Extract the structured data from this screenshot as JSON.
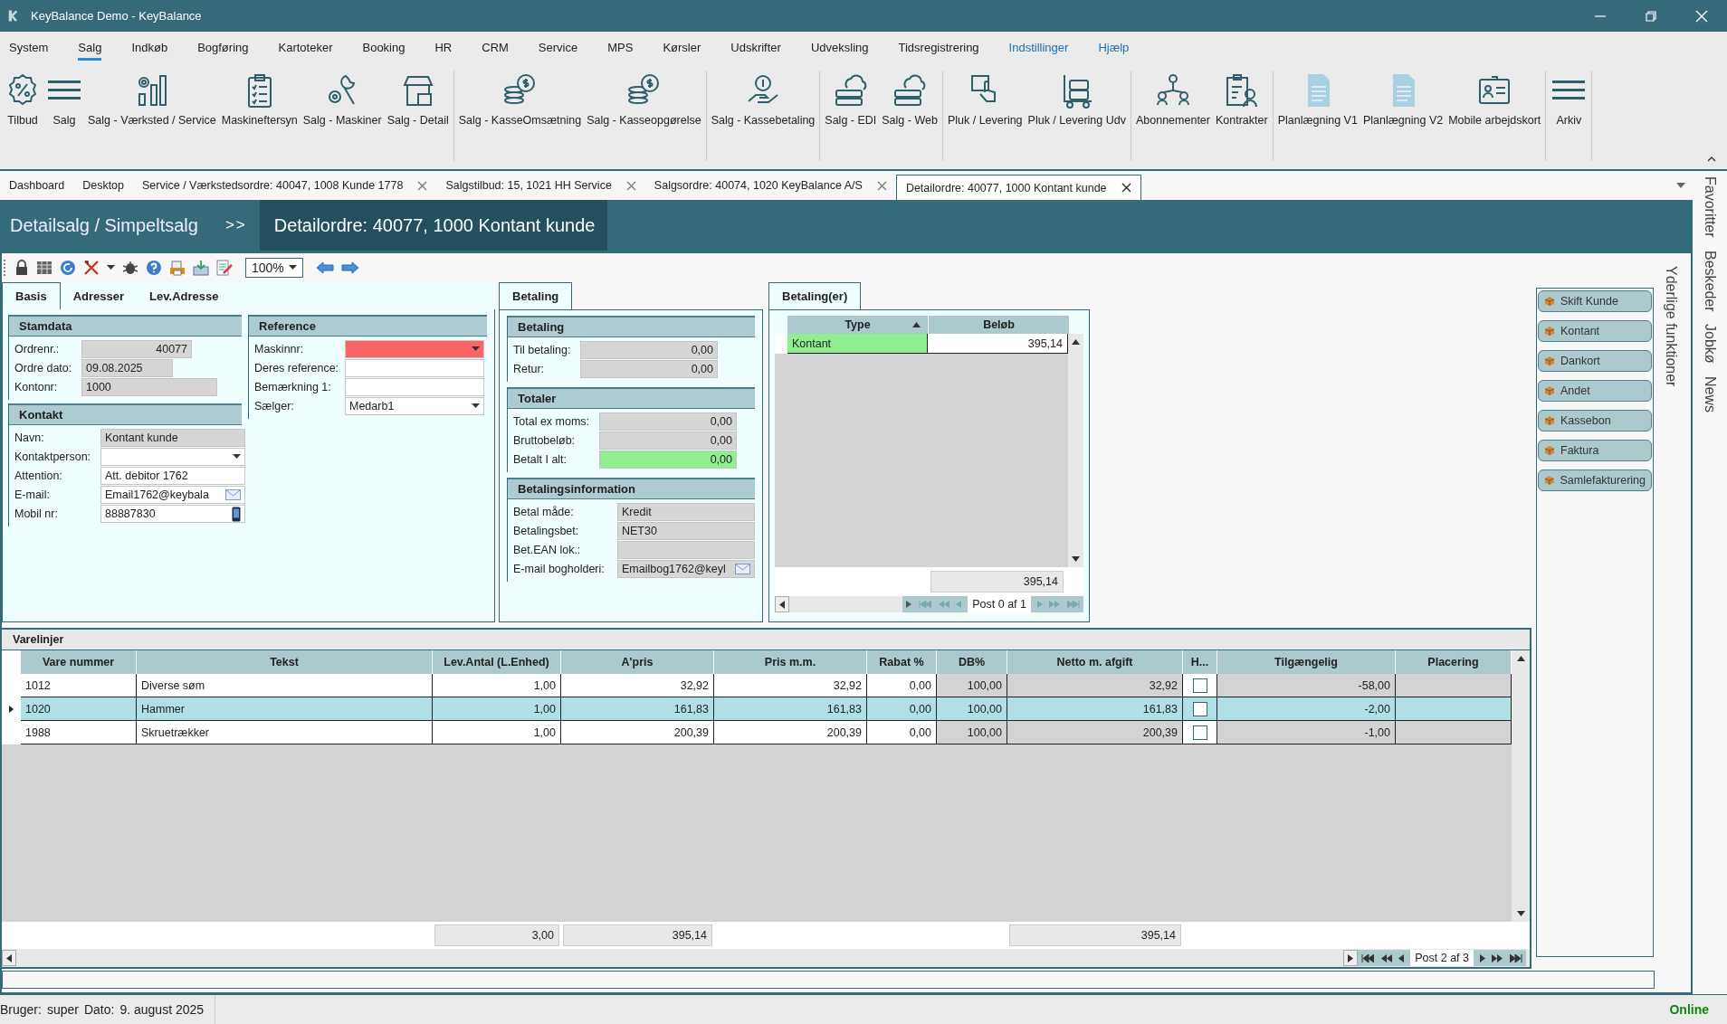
{
  "window": {
    "title": "KeyBalance Demo - KeyBalance"
  },
  "menu": [
    {
      "label": "System",
      "selected": false,
      "kind": "plain"
    },
    {
      "label": "Salg",
      "selected": true,
      "kind": "plain"
    },
    {
      "label": "Indkøb",
      "selected": false,
      "kind": "plain"
    },
    {
      "label": "Bogføring",
      "selected": false,
      "kind": "plain"
    },
    {
      "label": "Kartoteker",
      "selected": false,
      "kind": "plain"
    },
    {
      "label": "Booking",
      "selected": false,
      "kind": "plain"
    },
    {
      "label": "HR",
      "selected": false,
      "kind": "plain"
    },
    {
      "label": "CRM",
      "selected": false,
      "kind": "plain"
    },
    {
      "label": "Service",
      "selected": false,
      "kind": "plain"
    },
    {
      "label": "MPS",
      "selected": false,
      "kind": "plain"
    },
    {
      "label": "Kørsler",
      "selected": false,
      "kind": "plain"
    },
    {
      "label": "Udskrifter",
      "selected": false,
      "kind": "plain"
    },
    {
      "label": "Udveksling",
      "selected": false,
      "kind": "plain"
    },
    {
      "label": "Tidsregistrering",
      "selected": false,
      "kind": "plain"
    },
    {
      "label": "Indstillinger",
      "selected": false,
      "kind": "accent"
    },
    {
      "label": "Hjælp",
      "selected": false,
      "kind": "accent"
    }
  ],
  "ribbon": [
    {
      "items": [
        {
          "label": "Tilbud"
        },
        {
          "label": "Salg"
        },
        {
          "label": "Salg - Værksted / Service"
        },
        {
          "label": "Maskineftersyn"
        },
        {
          "label": "Salg - Maskiner"
        },
        {
          "label": "Salg - Detail"
        }
      ]
    },
    {
      "items": [
        {
          "label": "Salg - KasseOmsætning"
        },
        {
          "label": "Salg - Kasseopgørelse"
        }
      ]
    },
    {
      "items": [
        {
          "label": "Salg - Kassebetaling"
        }
      ]
    },
    {
      "items": [
        {
          "label": "Salg - EDI"
        },
        {
          "label": "Salg - Web"
        }
      ]
    },
    {
      "items": [
        {
          "label": "Pluk / Levering"
        },
        {
          "label": "Pluk / Levering Udv"
        }
      ]
    },
    {
      "items": [
        {
          "label": "Abonnementer"
        },
        {
          "label": "Kontrakter"
        }
      ]
    },
    {
      "items": [
        {
          "label": "Planlægning V1"
        },
        {
          "label": "Planlægning V2"
        },
        {
          "label": "Mobile arbejdskort"
        }
      ]
    },
    {
      "items": [
        {
          "label": "Arkiv"
        }
      ]
    }
  ],
  "doc_tabs": [
    {
      "label": "Dashboard",
      "closable": false,
      "selected": false
    },
    {
      "label": "Desktop",
      "closable": false,
      "selected": false
    },
    {
      "label": "Service / Værkstedsordre: 40047, 1008 Kunde 1778",
      "closable": true,
      "selected": false
    },
    {
      "label": "Salgstilbud: 15, 1021 HH Service",
      "closable": true,
      "selected": false
    },
    {
      "label": "Salgsordre: 40074, 1020 KeyBalance A/S",
      "closable": true,
      "selected": false
    },
    {
      "label": "Detailordre: 40077, 1000 Kontant kunde",
      "closable": true,
      "selected": true
    }
  ],
  "header": {
    "breadcrumb": "Detailsalg / Simpeltsalg",
    "separator": ">>",
    "title": "Detailordre: 40077, 1000 Kontant kunde"
  },
  "toolbar": {
    "zoom": "100%"
  },
  "form": {
    "tabs": [
      {
        "label": "Basis",
        "selected": true
      },
      {
        "label": "Adresser",
        "selected": false
      },
      {
        "label": "Lev.Adresse",
        "selected": false
      }
    ],
    "sections": [
      {
        "title": "Stamdata",
        "fields": [
          {
            "label": "Ordrenr.:",
            "kind": "number",
            "value": "40077",
            "readonly": true
          },
          {
            "label": "Ordre dato:",
            "kind": "text",
            "value": "09.08.2025",
            "readonly": true
          },
          {
            "label": "Kontonr:",
            "kind": "text",
            "value": "1000",
            "readonly": true
          }
        ]
      },
      {
        "title": "Kontakt",
        "fields": [
          {
            "label": "Navn:",
            "kind": "text",
            "value": "Kontant kunde",
            "readonly": true
          },
          {
            "label": "Kontaktperson:",
            "kind": "dropdown",
            "readonly": false
          },
          {
            "label": "Attention:",
            "kind": "text",
            "value": "Att. debitor 1762",
            "readonly": false
          },
          {
            "label": "E-mail:",
            "kind": "email",
            "value": "Email1762@keybala",
            "readonly": false
          },
          {
            "label": "Mobil nr:",
            "kind": "phone",
            "value": "88887830",
            "readonly": false
          }
        ]
      },
      {
        "title": "Reference",
        "fields": [
          {
            "label": "Maskinnr:",
            "kind": "dropdown",
            "readonly": false,
            "invalid": true
          },
          {
            "label": "Deres reference:",
            "kind": "text",
            "readonly": false
          },
          {
            "label": "Bemærkning 1:",
            "kind": "text",
            "readonly": false
          },
          {
            "label": "Sælger:",
            "kind": "dropdown",
            "value": "Medarb1",
            "readonly": false
          }
        ]
      }
    ]
  },
  "payment": {
    "tabs": [
      {
        "label": "Betaling",
        "selected": true
      }
    ],
    "sections": [
      {
        "title": "Betaling",
        "fields": [
          {
            "label": "Til betaling:",
            "kind": "number",
            "value": "0,00",
            "readonly": true
          },
          {
            "label": "Retur:",
            "kind": "number",
            "value": "0,00",
            "readonly": true
          }
        ]
      },
      {
        "title": "Totaler",
        "fields": [
          {
            "label": "Total ex moms:",
            "kind": "number",
            "value": "0,00",
            "readonly": true
          },
          {
            "label": "Bruttobeløb:",
            "kind": "number",
            "value": "0,00",
            "readonly": true
          },
          {
            "label": "Betalt I alt:",
            "kind": "number",
            "value": "0,00",
            "readonly": true,
            "highlighted": true
          }
        ]
      },
      {
        "title": "Betalingsinformation",
        "fields": [
          {
            "label": "Betal måde:",
            "kind": "text",
            "value": "Kredit",
            "readonly": true
          },
          {
            "label": "Betalingsbet:",
            "kind": "text",
            "value": "NET30",
            "readonly": true
          },
          {
            "label": "Bet.EAN lok.:",
            "kind": "text",
            "readonly": true
          },
          {
            "label": "E-mail bogholderi:",
            "kind": "email",
            "value": "Emailbog1762@keyl",
            "readonly": true
          }
        ]
      }
    ]
  },
  "payments_list": {
    "tabs": [
      {
        "label": "Betaling(er)",
        "selected": true
      }
    ],
    "columns": [
      {
        "label": "Type",
        "sorted_ascending": true
      },
      {
        "label": "Beløb",
        "sorted_ascending": false
      }
    ],
    "rows": [
      {
        "type": "Kontant",
        "amount": "395,14",
        "highlighted": true
      }
    ],
    "total": "395,14",
    "pager": "Post 0 af 1"
  },
  "functions": {
    "title": "Yderlige funktioner",
    "buttons": [
      {
        "label": "Skift Kunde"
      },
      {
        "label": "Kontant"
      },
      {
        "label": "Dankort"
      },
      {
        "label": "Andet"
      },
      {
        "label": "Kassebon"
      },
      {
        "label": "Faktura"
      },
      {
        "label": "Samlefakturering"
      }
    ]
  },
  "lines": {
    "title": "Varelinjer",
    "columns": [
      {
        "label": "Vare nummer",
        "kind": "text",
        "readonly": false
      },
      {
        "label": "Tekst",
        "kind": "text",
        "readonly": false
      },
      {
        "label": "Lev.Antal (L.Enhed)",
        "kind": "number",
        "readonly": false
      },
      {
        "label": "A'pris",
        "kind": "number",
        "readonly": false
      },
      {
        "label": "Pris m.m.",
        "kind": "number",
        "readonly": false
      },
      {
        "label": "Rabat %",
        "kind": "number",
        "readonly": false
      },
      {
        "label": "DB%",
        "kind": "number",
        "readonly": true
      },
      {
        "label": "Netto m. afgift",
        "kind": "number",
        "readonly": true
      },
      {
        "label": "H...",
        "kind": "check",
        "readonly": false
      },
      {
        "label": "Tilgængelig",
        "kind": "number",
        "readonly": true
      },
      {
        "label": "Placering",
        "kind": "text",
        "readonly": true
      }
    ],
    "rows": [
      {
        "selected": false,
        "checked": false,
        "cells": [
          "1012",
          "Diverse søm",
          "1,00",
          "32,92",
          "32,92",
          "0,00",
          "100,00",
          "32,92",
          "-58,00"
        ]
      },
      {
        "selected": true,
        "checked": false,
        "cells": [
          "1020",
          "Hammer",
          "1,00",
          "161,83",
          "161,83",
          "0,00",
          "100,00",
          "161,83",
          "-2,00"
        ]
      },
      {
        "selected": false,
        "checked": false,
        "cells": [
          "1988",
          "Skruetrækker",
          "1,00",
          "200,39",
          "200,39",
          "0,00",
          "100,00",
          "200,39",
          "-1,00"
        ]
      }
    ],
    "totals": {
      "quantity": "3,00",
      "unit_price": "395,14",
      "net": "395,14"
    },
    "pager": "Post 2 af 3"
  },
  "sidebar": [
    {
      "label": "Favoritter"
    },
    {
      "label": "Beskeder"
    },
    {
      "label": "Jobkø"
    },
    {
      "label": "News"
    }
  ],
  "status_bar": {
    "user_label": "Bruger:",
    "user": "super",
    "date_label": "Dato:",
    "date": "9. august 2025",
    "connection": "Online"
  }
}
